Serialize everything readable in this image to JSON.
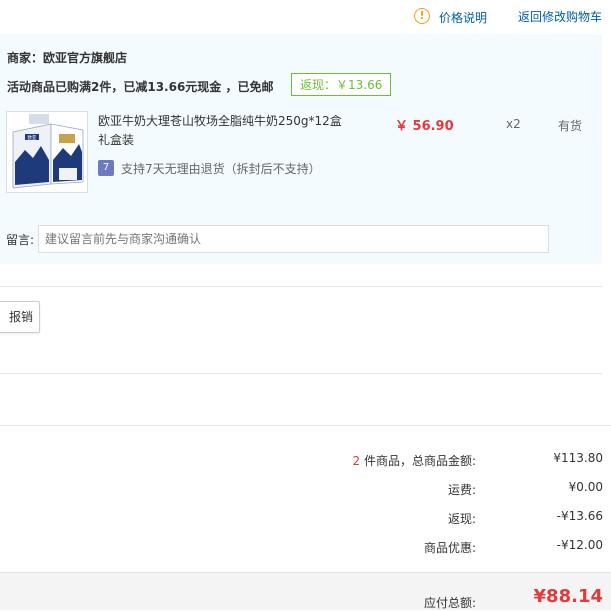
{
  "header": {
    "price_note": "价格说明",
    "back_to_cart": "返回修改购物车"
  },
  "shop": {
    "seller": "商家：欧亚官方旗舰店",
    "promo": "活动商品已购满2件，已减13.66元现金 ，已免邮",
    "rebate_tag": "返现：￥13.66"
  },
  "product": {
    "name": "欧亚牛奶大理苍山牧场全脂纯牛奶250g*12盒礼盒装",
    "price": "￥ 56.90",
    "quantity": "x2",
    "stock": "有货",
    "return_policy": "支持7天无理由退货（拆封后不支持）",
    "image_text": "欧亚"
  },
  "message": {
    "label": "留言:",
    "placeholder": "建议留言前先与商家沟通确认"
  },
  "invoice": {
    "reimburse_label": "报销"
  },
  "summary": {
    "count": "2",
    "count_suffix": " 件商品，总商品金额:",
    "goods_total": "¥113.80",
    "shipping_label": "运费:",
    "shipping": "¥0.00",
    "rebate_label": "返现:",
    "rebate": "-¥13.66",
    "discount_label": "商品优惠:",
    "discount": "-¥12.00",
    "total_label": "应付总额:",
    "total": "¥88.14"
  },
  "colors": {
    "accent_red": "#e4393c",
    "link_blue": "#005ea7",
    "rebate_green": "#6cbf3a",
    "panel_bg": "#f3fbfe"
  }
}
